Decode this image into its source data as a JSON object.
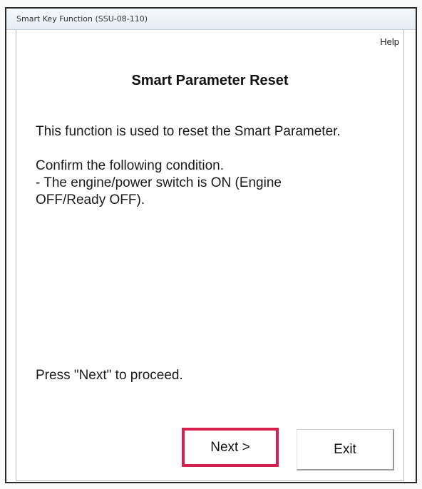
{
  "window": {
    "title": "Smart Key Function (SSU-08-110)"
  },
  "toolbar": {
    "help_label": "Help"
  },
  "main": {
    "heading": "Smart Parameter Reset",
    "description": "This function is used to reset the Smart Parameter.",
    "condition_intro": "Confirm the following condition.",
    "condition_line_1": "- The engine/power switch is ON (Engine",
    "condition_line_2": "OFF/Ready OFF).",
    "proceed_hint": "Press \"Next\" to proceed."
  },
  "buttons": {
    "next_label": "Next >",
    "exit_label": "Exit"
  },
  "colors": {
    "highlight_border": "#d8204f",
    "text": "#1a1a1a",
    "window_border": "#2a2a2a"
  }
}
